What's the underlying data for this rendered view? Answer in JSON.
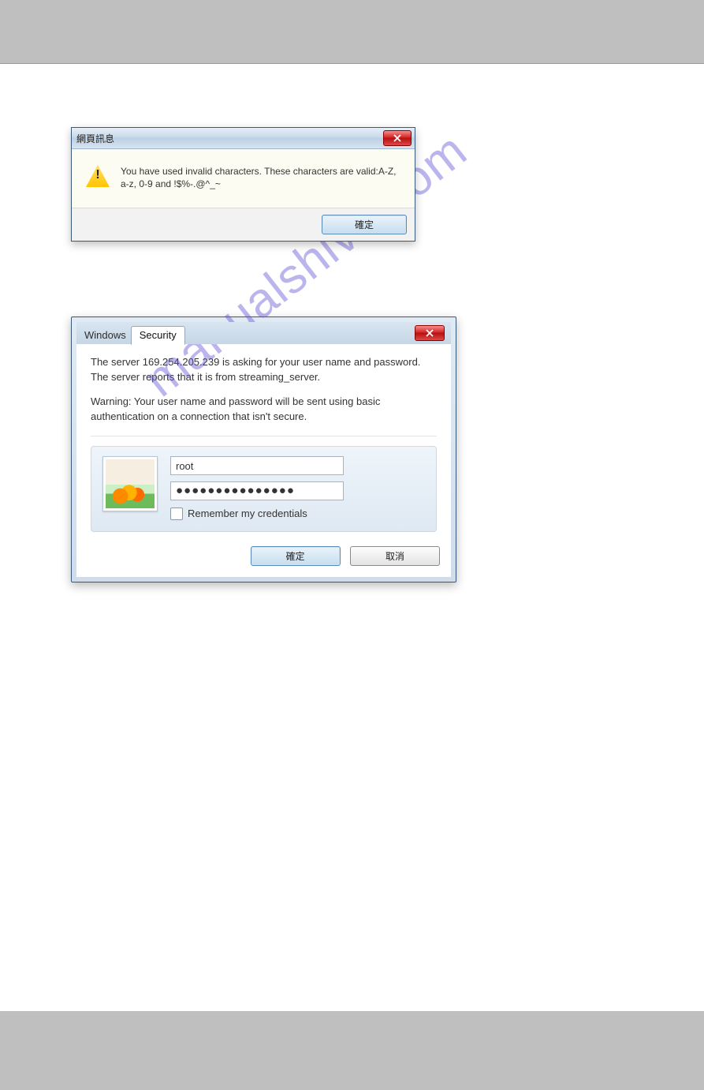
{
  "dialog1": {
    "title": "網頁訊息",
    "message": "You have used invalid characters. These characters are valid:A-Z, a-z, 0-9 and !$%-.@^_~",
    "ok_label": "確定"
  },
  "dialog2": {
    "title_prefix": "Windows",
    "title_tab": "Security",
    "body_line1": "The server 169.254.205.239 is asking for your user name and password. The server reports that it is from streaming_server.",
    "body_line2": "Warning: Your user name and password will be sent using basic authentication on a connection that isn't secure.",
    "username_value": "root",
    "password_masked": "●●●●●●●●●●●●●●●",
    "remember_label": "Remember my credentials",
    "ok_label": "確定",
    "cancel_label": "取消"
  },
  "watermark": "manualshive.com"
}
